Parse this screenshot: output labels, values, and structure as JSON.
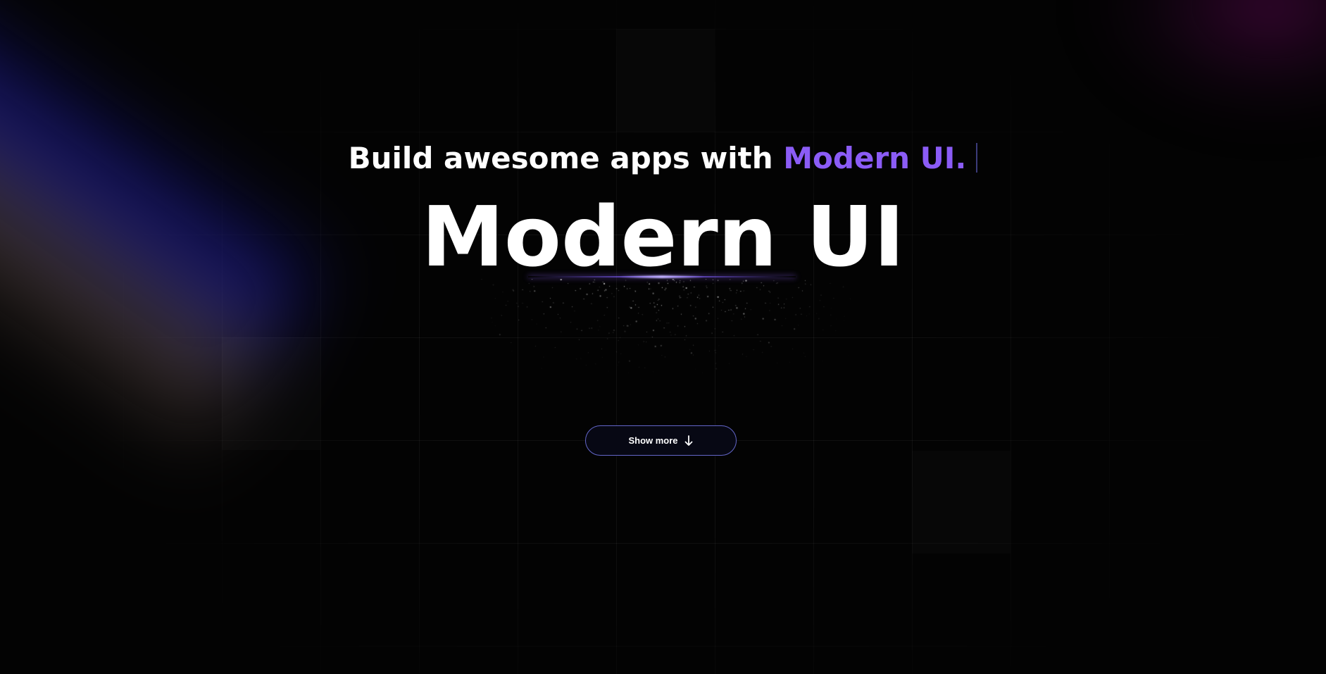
{
  "hero": {
    "tagline_prefix": "Build awesome apps with",
    "tagline_accent": "Modern UI.",
    "title": "Modern UI"
  },
  "cta": {
    "label": "Show more",
    "icon": "arrow-down-icon"
  },
  "colors": {
    "background": "#030303",
    "accent": "#8b5cf6",
    "button_border": "#6366c9",
    "button_bg": "#070814"
  }
}
